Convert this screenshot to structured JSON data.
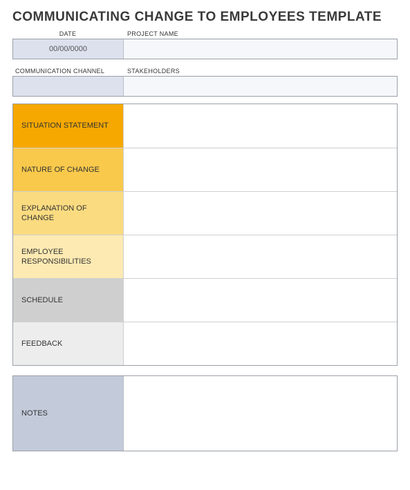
{
  "title": "COMMUNICATING CHANGE TO EMPLOYEES TEMPLATE",
  "meta1": {
    "header_left": "DATE",
    "header_right": "PROJECT NAME",
    "value_left": "00/00/0000",
    "value_right": ""
  },
  "meta2": {
    "header_left": "COMMUNICATION CHANNEL",
    "header_right": "STAKEHOLDERS",
    "value_left": "",
    "value_right": ""
  },
  "sections": [
    {
      "label": "SITUATION STATEMENT",
      "value": ""
    },
    {
      "label": "NATURE OF CHANGE",
      "value": ""
    },
    {
      "label": "EXPLANATION OF CHANGE",
      "value": ""
    },
    {
      "label": "EMPLOYEE RESPONSIBILITIES",
      "value": ""
    },
    {
      "label": "SCHEDULE",
      "value": ""
    },
    {
      "label": "FEEDBACK",
      "value": ""
    }
  ],
  "notes": {
    "label": "NOTES",
    "value": ""
  }
}
